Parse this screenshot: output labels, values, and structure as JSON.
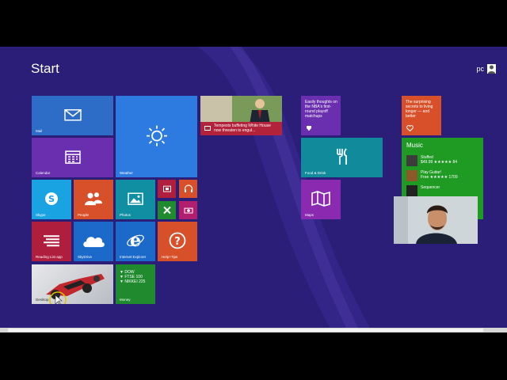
{
  "screen": {
    "title": "Start",
    "user": "pc"
  },
  "tiles": {
    "mail": "Mail",
    "calendar": "Calendar",
    "weather": "Weather",
    "news_headline": "Tempests buffeting White House now threaten to engul...",
    "skype": "Skype",
    "people": "People",
    "photos": "Photos",
    "reading_list": "Reading List app",
    "skydrive": "SkyDrive",
    "ie": "Internet Explorer",
    "help": "Help+Tips",
    "desktop": "Desktop",
    "money": "Money",
    "money_lines": [
      "▼ DOW",
      "▼ FTSE 100",
      "▼ NIKKEI 225"
    ],
    "health_text": "Easily thoughts on the NBA's first-round playoff matchups",
    "food_health": "The surprising secrets to living longer — and better",
    "food": "Food & Drink",
    "maps": "Maps",
    "music": {
      "title": "Music",
      "items": [
        {
          "name": "Stuffed",
          "detail": "$49.99 ★★★★★ 84"
        },
        {
          "name": "Play Guitar!",
          "detail": "Free ★★★★★ 1709"
        },
        {
          "name": "Sequencer",
          "detail": ""
        }
      ]
    }
  },
  "colors": {
    "background": "#2a1e78",
    "mail": "#2d6dc8",
    "calendar": "#6a2fae",
    "weather": "#2d7ae0",
    "skype": "#1aa3e3",
    "people": "#d8502a",
    "photos": "#0f8fa1",
    "reading": "#b01e3d",
    "skydrive": "#1b69c9",
    "ie": "#1b69c9",
    "help": "#d8502a",
    "money": "#1f8a2e",
    "food": "#118b9c",
    "maps": "#8a2ab1",
    "music": "#1f9a23",
    "news": "#b2223b",
    "health": "#d8502a"
  }
}
